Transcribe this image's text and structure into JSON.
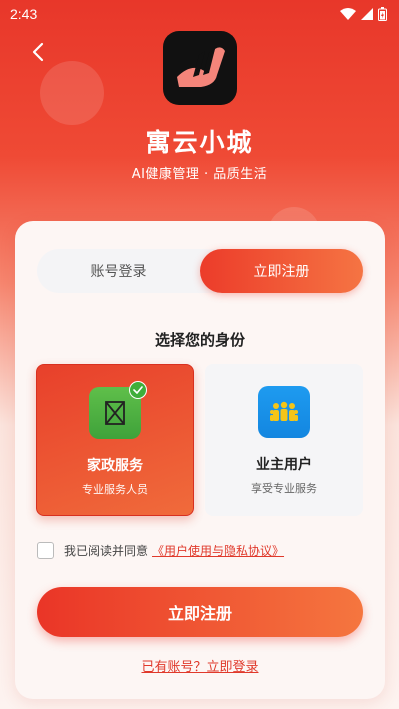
{
  "status_bar": {
    "time": "2:43",
    "icons": [
      "wifi-icon",
      "signal-icon",
      "battery-icon"
    ]
  },
  "header": {
    "back_icon": "chevron-left-icon",
    "app_name": "寓云小城",
    "slogan": "AI健康管理 · 品质生活"
  },
  "tabs": [
    {
      "label": "账号登录",
      "active": false
    },
    {
      "label": "立即注册",
      "active": true
    }
  ],
  "identity": {
    "title": "选择您的身份",
    "roles": [
      {
        "title": "家政服务",
        "desc": "专业服务人员",
        "icon": "housekeeping-icon",
        "selected": true
      },
      {
        "title": "业主用户",
        "desc": "享受专业服务",
        "icon": "family-users-icon",
        "selected": false
      }
    ]
  },
  "agreement": {
    "checked": false,
    "text": "我已阅读并同意",
    "link": "《用户使用与隐私协议》"
  },
  "submit_label": "立即注册",
  "login_link": "已有账号？立即登录",
  "colors": {
    "primary": "#e8372a",
    "accent_end": "#f5763f",
    "link": "#e0392b"
  }
}
